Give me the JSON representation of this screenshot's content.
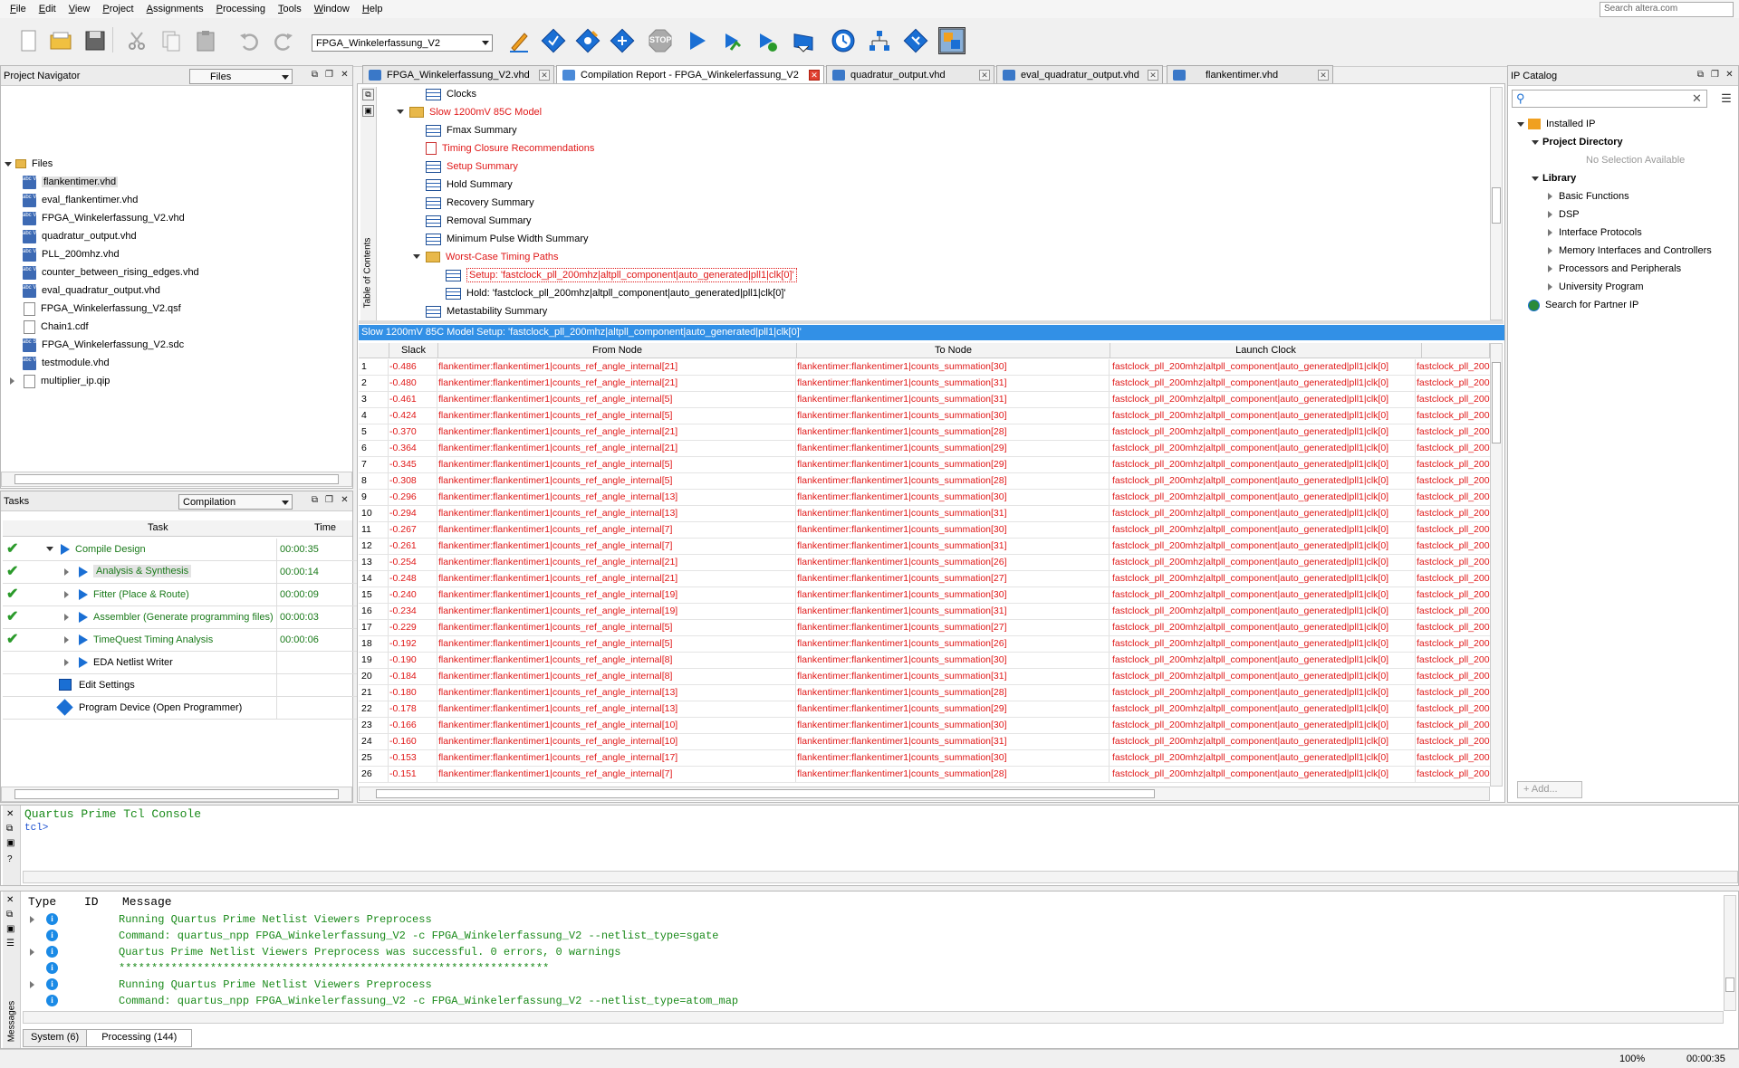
{
  "menu": [
    "File",
    "Edit",
    "View",
    "Project",
    "Assignments",
    "Processing",
    "Tools",
    "Window",
    "Help"
  ],
  "search_placeholder": "Search altera.com",
  "toolbar": {
    "project_select": "FPGA_Winkelerfassung_V2",
    "icons": [
      "new-file-icon",
      "open-folder-icon",
      "save-icon",
      "cut-icon",
      "copy-icon",
      "paste-icon",
      "undo-icon",
      "redo-icon",
      "edit-icon",
      "analysis-icon",
      "synthesis-icon",
      "fitter-icon",
      "stop-icon",
      "start-compilation-icon",
      "assembler-icon",
      "timing-analysis-icon",
      "eda-netlist-icon",
      "compilation-report-icon",
      "rtl-viewer-icon",
      "programmer-icon",
      "chip-planner-icon"
    ],
    "stop_label": "STOP"
  },
  "project_navigator": {
    "title": "Project Navigator",
    "select": "Files",
    "root": "Files",
    "files": [
      {
        "name": "flankentimer.vhd",
        "type": "vhd",
        "selected": true
      },
      {
        "name": "eval_flankentimer.vhd",
        "type": "vhd"
      },
      {
        "name": "FPGA_Winkelerfassung_V2.vhd",
        "type": "vhd"
      },
      {
        "name": "quadratur_output.vhd",
        "type": "vhd"
      },
      {
        "name": "PLL_200mhz.vhd",
        "type": "vhd"
      },
      {
        "name": "counter_between_rising_edges.vhd",
        "type": "vhd"
      },
      {
        "name": "eval_quadratur_output.vhd",
        "type": "vhd"
      },
      {
        "name": "FPGA_Winkelerfassung_V2.qsf",
        "type": "file"
      },
      {
        "name": "Chain1.cdf",
        "type": "file"
      },
      {
        "name": "FPGA_Winkelerfassung_V2.sdc",
        "type": "sdc"
      },
      {
        "name": "testmodule.vhd",
        "type": "vhd"
      },
      {
        "name": "multiplier_ip.qip",
        "type": "file"
      }
    ],
    "vhd_badge": "abc VHD",
    "sdc_badge": "abc SDC"
  },
  "tasks": {
    "title": "Tasks",
    "select": "Compilation",
    "col_task": "Task",
    "col_time": "Time",
    "rows": [
      {
        "label": "Compile Design",
        "time": "00:00:35",
        "done": true,
        "level": 0
      },
      {
        "label": "Analysis & Synthesis",
        "time": "00:00:14",
        "done": true,
        "level": 1,
        "highlight": true
      },
      {
        "label": "Fitter (Place & Route)",
        "time": "00:00:09",
        "done": true,
        "level": 1
      },
      {
        "label": "Assembler (Generate programming files)",
        "time": "00:00:03",
        "done": true,
        "level": 1
      },
      {
        "label": "TimeQuest Timing Analysis",
        "time": "00:00:06",
        "done": true,
        "level": 1
      },
      {
        "label": "EDA Netlist Writer",
        "time": "",
        "done": false,
        "level": 1
      },
      {
        "label": "Edit Settings",
        "time": "",
        "done": false,
        "level": 0
      },
      {
        "label": "Program Device (Open Programmer)",
        "time": "",
        "done": false,
        "level": 0
      }
    ]
  },
  "doc_tabs": [
    {
      "label": "FPGA_Winkelerfassung_V2.vhd"
    },
    {
      "label": "Compilation Report - FPGA_Winkelerfassung_V2",
      "active": true
    },
    {
      "label": "quadratur_output.vhd"
    },
    {
      "label": "eval_quadratur_output.vhd"
    },
    {
      "label": "flankentimer.vhd"
    }
  ],
  "report_toc": {
    "side_label": "Table of Contents",
    "items": [
      {
        "label": "Clocks",
        "icon": "table",
        "level": 2,
        "red": false
      },
      {
        "label": "Slow 1200mV 85C Model",
        "icon": "folder",
        "level": 1,
        "red": true,
        "expanded": true
      },
      {
        "label": "Fmax Summary",
        "icon": "table",
        "level": 2,
        "red": false
      },
      {
        "label": "Timing Closure Recommendations",
        "icon": "doc",
        "level": 2,
        "red": true
      },
      {
        "label": "Setup Summary",
        "icon": "table",
        "level": 2,
        "red": true
      },
      {
        "label": "Hold Summary",
        "icon": "table",
        "level": 2,
        "red": false
      },
      {
        "label": "Recovery Summary",
        "icon": "table",
        "level": 2,
        "red": false
      },
      {
        "label": "Removal Summary",
        "icon": "table",
        "level": 2,
        "red": false
      },
      {
        "label": "Minimum Pulse Width Summary",
        "icon": "table",
        "level": 2,
        "red": false
      },
      {
        "label": "Worst-Case Timing Paths",
        "icon": "folder",
        "level": 2,
        "red": true,
        "expanded": true
      },
      {
        "label": "Setup: 'fastclock_pll_200mhz|altpll_component|auto_generated|pll1|clk[0]'",
        "icon": "table",
        "level": 3,
        "red": true,
        "selected": true
      },
      {
        "label": "Hold: 'fastclock_pll_200mhz|altpll_component|auto_generated|pll1|clk[0]'",
        "icon": "table",
        "level": 3,
        "red": false
      },
      {
        "label": "Metastability Summary",
        "icon": "table",
        "level": 2,
        "red": false
      }
    ]
  },
  "timing_table": {
    "title": "Slow 1200mV 85C Model Setup: 'fastclock_pll_200mhz|altpll_component|auto_generated|pll1|clk[0]'",
    "columns": [
      "Slack",
      "From Node",
      "To Node",
      "Launch Clock"
    ],
    "launch_clock": "fastclock_pll_200mhz|altpll_component|auto_generated|pll1|clk[0]",
    "latch_clock_trunc": "fastclock_pll_200",
    "rows": [
      [
        "1",
        "-0.486",
        "flankentimer:flankentimer1|counts_ref_angle_internal[21]",
        "flankentimer:flankentimer1|counts_summation[30]"
      ],
      [
        "2",
        "-0.480",
        "flankentimer:flankentimer1|counts_ref_angle_internal[21]",
        "flankentimer:flankentimer1|counts_summation[31]"
      ],
      [
        "3",
        "-0.461",
        "flankentimer:flankentimer1|counts_ref_angle_internal[5]",
        "flankentimer:flankentimer1|counts_summation[31]"
      ],
      [
        "4",
        "-0.424",
        "flankentimer:flankentimer1|counts_ref_angle_internal[5]",
        "flankentimer:flankentimer1|counts_summation[30]"
      ],
      [
        "5",
        "-0.370",
        "flankentimer:flankentimer1|counts_ref_angle_internal[21]",
        "flankentimer:flankentimer1|counts_summation[28]"
      ],
      [
        "6",
        "-0.364",
        "flankentimer:flankentimer1|counts_ref_angle_internal[21]",
        "flankentimer:flankentimer1|counts_summation[29]"
      ],
      [
        "7",
        "-0.345",
        "flankentimer:flankentimer1|counts_ref_angle_internal[5]",
        "flankentimer:flankentimer1|counts_summation[29]"
      ],
      [
        "8",
        "-0.308",
        "flankentimer:flankentimer1|counts_ref_angle_internal[5]",
        "flankentimer:flankentimer1|counts_summation[28]"
      ],
      [
        "9",
        "-0.296",
        "flankentimer:flankentimer1|counts_ref_angle_internal[13]",
        "flankentimer:flankentimer1|counts_summation[30]"
      ],
      [
        "10",
        "-0.294",
        "flankentimer:flankentimer1|counts_ref_angle_internal[13]",
        "flankentimer:flankentimer1|counts_summation[31]"
      ],
      [
        "11",
        "-0.267",
        "flankentimer:flankentimer1|counts_ref_angle_internal[7]",
        "flankentimer:flankentimer1|counts_summation[30]"
      ],
      [
        "12",
        "-0.261",
        "flankentimer:flankentimer1|counts_ref_angle_internal[7]",
        "flankentimer:flankentimer1|counts_summation[31]"
      ],
      [
        "13",
        "-0.254",
        "flankentimer:flankentimer1|counts_ref_angle_internal[21]",
        "flankentimer:flankentimer1|counts_summation[26]"
      ],
      [
        "14",
        "-0.248",
        "flankentimer:flankentimer1|counts_ref_angle_internal[21]",
        "flankentimer:flankentimer1|counts_summation[27]"
      ],
      [
        "15",
        "-0.240",
        "flankentimer:flankentimer1|counts_ref_angle_internal[19]",
        "flankentimer:flankentimer1|counts_summation[30]"
      ],
      [
        "16",
        "-0.234",
        "flankentimer:flankentimer1|counts_ref_angle_internal[19]",
        "flankentimer:flankentimer1|counts_summation[31]"
      ],
      [
        "17",
        "-0.229",
        "flankentimer:flankentimer1|counts_ref_angle_internal[5]",
        "flankentimer:flankentimer1|counts_summation[27]"
      ],
      [
        "18",
        "-0.192",
        "flankentimer:flankentimer1|counts_ref_angle_internal[5]",
        "flankentimer:flankentimer1|counts_summation[26]"
      ],
      [
        "19",
        "-0.190",
        "flankentimer:flankentimer1|counts_ref_angle_internal[8]",
        "flankentimer:flankentimer1|counts_summation[30]"
      ],
      [
        "20",
        "-0.184",
        "flankentimer:flankentimer1|counts_ref_angle_internal[8]",
        "flankentimer:flankentimer1|counts_summation[31]"
      ],
      [
        "21",
        "-0.180",
        "flankentimer:flankentimer1|counts_ref_angle_internal[13]",
        "flankentimer:flankentimer1|counts_summation[28]"
      ],
      [
        "22",
        "-0.178",
        "flankentimer:flankentimer1|counts_ref_angle_internal[13]",
        "flankentimer:flankentimer1|counts_summation[29]"
      ],
      [
        "23",
        "-0.166",
        "flankentimer:flankentimer1|counts_ref_angle_internal[10]",
        "flankentimer:flankentimer1|counts_summation[30]"
      ],
      [
        "24",
        "-0.160",
        "flankentimer:flankentimer1|counts_ref_angle_internal[10]",
        "flankentimer:flankentimer1|counts_summation[31]"
      ],
      [
        "25",
        "-0.153",
        "flankentimer:flankentimer1|counts_ref_angle_internal[17]",
        "flankentimer:flankentimer1|counts_summation[30]"
      ],
      [
        "26",
        "-0.151",
        "flankentimer:flankentimer1|counts_ref_angle_internal[7]",
        "flankentimer:flankentimer1|counts_summation[28]"
      ]
    ]
  },
  "ip_catalog": {
    "title": "IP Catalog",
    "items": [
      {
        "label": "Installed IP",
        "level": 0,
        "bold": false
      },
      {
        "label": "Project Directory",
        "level": 1,
        "bold": true
      },
      {
        "label": "No Selection Available",
        "level": 2,
        "muted": true
      },
      {
        "label": "Library",
        "level": 1,
        "bold": true
      },
      {
        "label": "Basic Functions",
        "level": 2
      },
      {
        "label": "DSP",
        "level": 2
      },
      {
        "label": "Interface Protocols",
        "level": 2
      },
      {
        "label": "Memory Interfaces and Controllers",
        "level": 2
      },
      {
        "label": "Processors and Peripherals",
        "level": 2
      },
      {
        "label": "University Program",
        "level": 2
      },
      {
        "label": "Search for Partner IP",
        "level": 0
      }
    ],
    "add_button": "Add..."
  },
  "tcl_console": {
    "title": "Quartus Prime Tcl Console",
    "prompt": "tcl>"
  },
  "messages": {
    "columns": [
      "Type",
      "ID",
      "Message"
    ],
    "side_label": "Messages",
    "rows": [
      {
        "text": "Running Quartus Prime Netlist Viewers Preprocess",
        "expand": true
      },
      {
        "text": "Command: quartus_npp FPGA_Winkelerfassung_V2 -c FPGA_Winkelerfassung_V2 --netlist_type=sgate",
        "expand": false
      },
      {
        "text": "Quartus Prime Netlist Viewers Preprocess was successful. 0 errors, 0 warnings",
        "expand": true
      },
      {
        "text": "******************************************************************",
        "expand": false
      },
      {
        "text": "Running Quartus Prime Netlist Viewers Preprocess",
        "expand": true
      },
      {
        "text": "Command: quartus_npp FPGA_Winkelerfassung_V2 -c FPGA_Winkelerfassung_V2 --netlist_type=atom_map",
        "expand": false
      }
    ],
    "tabs": [
      "System (6)",
      "Processing (144)"
    ]
  },
  "status": {
    "zoom": "100%",
    "elapsed": "00:00:35"
  },
  "colors": {
    "accent": "#3290e6",
    "error": "#e01818",
    "success": "#1a8a1a"
  }
}
